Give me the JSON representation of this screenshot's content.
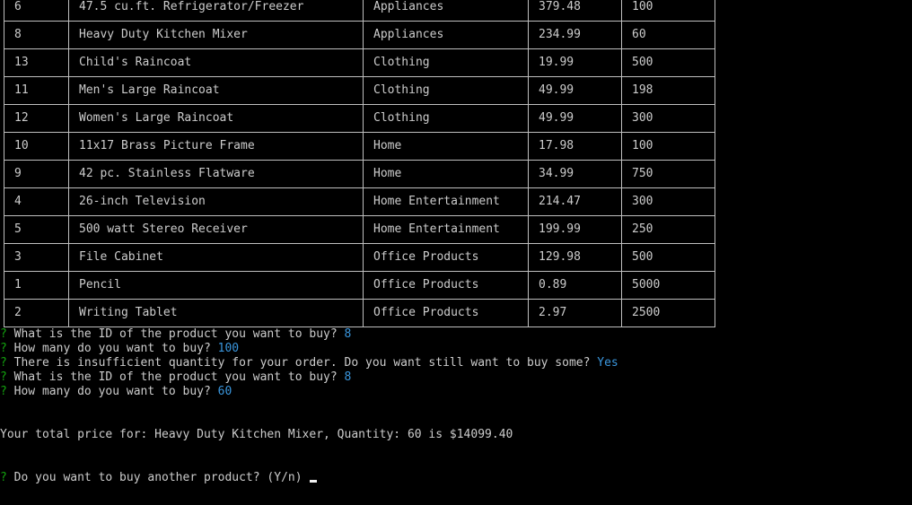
{
  "table": {
    "rows": [
      {
        "id": "6",
        "name": "47.5 cu.ft. Refrigerator/Freezer",
        "department": "Appliances",
        "price": "379.48",
        "quantity": "100"
      },
      {
        "id": "8",
        "name": "Heavy Duty Kitchen Mixer",
        "department": "Appliances",
        "price": "234.99",
        "quantity": "60"
      },
      {
        "id": "13",
        "name": "Child's Raincoat",
        "department": "Clothing",
        "price": "19.99",
        "quantity": "500"
      },
      {
        "id": "11",
        "name": "Men's Large Raincoat",
        "department": "Clothing",
        "price": "49.99",
        "quantity": "198"
      },
      {
        "id": "12",
        "name": "Women's Large Raincoat",
        "department": "Clothing",
        "price": "49.99",
        "quantity": "300"
      },
      {
        "id": "10",
        "name": "11x17 Brass Picture Frame",
        "department": "Home",
        "price": "17.98",
        "quantity": "100"
      },
      {
        "id": "9",
        "name": "42 pc. Stainless Flatware",
        "department": "Home",
        "price": "34.99",
        "quantity": "750"
      },
      {
        "id": "4",
        "name": "26-inch Television",
        "department": "Home Entertainment",
        "price": "214.47",
        "quantity": "300"
      },
      {
        "id": "5",
        "name": "500 watt Stereo Receiver",
        "department": "Home Entertainment",
        "price": "199.99",
        "quantity": "250"
      },
      {
        "id": "3",
        "name": "File Cabinet",
        "department": "Office Products",
        "price": "129.98",
        "quantity": "500"
      },
      {
        "id": "1",
        "name": "Pencil",
        "department": "Office Products",
        "price": "0.89",
        "quantity": "5000"
      },
      {
        "id": "2",
        "name": "Writing Tablet",
        "department": "Office Products",
        "price": "2.97",
        "quantity": "2500"
      }
    ]
  },
  "prompts": [
    {
      "mark": "?",
      "question": "What is the ID of the product you want to buy?",
      "answer": "8"
    },
    {
      "mark": "?",
      "question": "How many do you want to buy?",
      "answer": "100"
    },
    {
      "mark": "?",
      "question": "There is insufficient quantity for your order. Do you want still want to buy some?",
      "answer": "Yes"
    },
    {
      "mark": "?",
      "question": "What is the ID of the product you want to buy?",
      "answer": "8"
    },
    {
      "mark": "?",
      "question": "How many do you want to buy?",
      "answer": "60"
    }
  ],
  "summary": "Your total price for: Heavy Duty Kitchen Mixer, Quantity: 60 is $14099.40",
  "final_prompt": {
    "mark": "?",
    "question": "Do you want to buy another product?",
    "hint": "(Y/n)"
  },
  "colors": {
    "background": "#000000",
    "text": "#cccccc",
    "prompt_mark": "#13a10e",
    "answer": "#3a96dd",
    "border": "#bfbfbf"
  }
}
